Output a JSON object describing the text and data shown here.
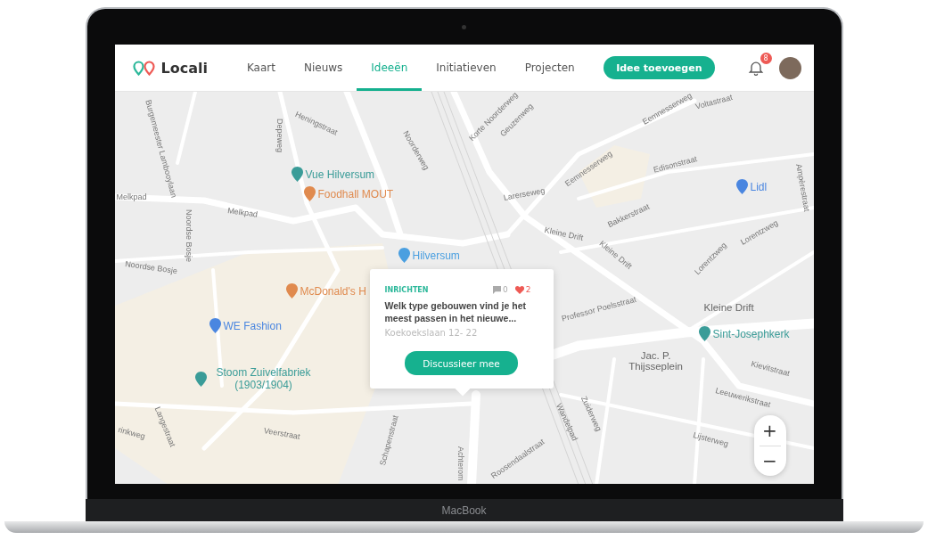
{
  "app": {
    "logo": "Locali"
  },
  "nav": [
    {
      "label": "Kaart",
      "selected": false
    },
    {
      "label": "Nieuws",
      "selected": false
    },
    {
      "label": "Ideeën",
      "selected": true
    },
    {
      "label": "Initiatieven",
      "selected": false
    },
    {
      "label": "Projecten",
      "selected": false
    }
  ],
  "add_button": "Idee toevoegen",
  "notifications": {
    "count": "8"
  },
  "map": {
    "labels": [
      {
        "kind": "poi",
        "text": "Vue Hilversum",
        "color": "#3a9c98"
      },
      {
        "kind": "poi",
        "text": "Foodhall MOUT",
        "color": "#e08a4e"
      },
      {
        "kind": "poi",
        "text": "McDonald's H",
        "color": "#e08a4e"
      },
      {
        "kind": "poi",
        "text": "WE Fashion",
        "color": "#4a86e0"
      },
      {
        "kind": "poi",
        "text": "Hilversum",
        "color": "#4a9fe0"
      },
      {
        "kind": "poi",
        "text": "Lidl",
        "color": "#4a86e0"
      },
      {
        "kind": "poi",
        "text": "Sint-Josephkerk",
        "color": "#3a9c98"
      },
      {
        "kind": "poi",
        "text": "Stoom Zuivelfabriek (1903/1904)",
        "color": "#3a9c98"
      },
      {
        "kind": "place",
        "text": "Kleine Drift"
      },
      {
        "kind": "place",
        "text": "Jac. P. Thijsseplein"
      },
      {
        "kind": "street",
        "text": "Melkpad"
      },
      {
        "kind": "street",
        "text": "Melkpad"
      },
      {
        "kind": "street",
        "text": "Heningstraat"
      },
      {
        "kind": "street",
        "text": "Depeweg"
      },
      {
        "kind": "street",
        "text": "Burgemeester Lambooylaan"
      },
      {
        "kind": "street",
        "text": "Noordse Bosje"
      },
      {
        "kind": "street",
        "text": "Noordse Bosje"
      },
      {
        "kind": "street",
        "text": "Noorderweg"
      },
      {
        "kind": "street",
        "text": "Korte Noorderweg"
      },
      {
        "kind": "street",
        "text": "Geuzenweg"
      },
      {
        "kind": "street",
        "text": "Larerseweg"
      },
      {
        "kind": "street",
        "text": "Eemnesserweg"
      },
      {
        "kind": "street",
        "text": "Eemnesserweg"
      },
      {
        "kind": "street",
        "text": "Edisonstraat"
      },
      {
        "kind": "street",
        "text": "Voltastraat"
      },
      {
        "kind": "street",
        "text": "Bakkerstraat"
      },
      {
        "kind": "street",
        "text": "Kleine Drift"
      },
      {
        "kind": "street",
        "text": "Kleine Drift"
      },
      {
        "kind": "street",
        "text": "Lorentzweg"
      },
      {
        "kind": "street",
        "text": "Lorentzweg"
      },
      {
        "kind": "street",
        "text": "Ampèrestraat"
      },
      {
        "kind": "street",
        "text": "Professor Poelsstraat"
      },
      {
        "kind": "street",
        "text": "Kievitstraat"
      },
      {
        "kind": "street",
        "text": "Leeuwerikstraat"
      },
      {
        "kind": "street",
        "text": "Lijsterweg"
      },
      {
        "kind": "street",
        "text": "Zuiderweg"
      },
      {
        "kind": "street",
        "text": "Wandelpad"
      },
      {
        "kind": "street",
        "text": "Roosendaalstraat"
      },
      {
        "kind": "street",
        "text": "Achterom"
      },
      {
        "kind": "street",
        "text": "Schapenstraat"
      },
      {
        "kind": "street",
        "text": "Veerstraat"
      },
      {
        "kind": "street",
        "text": "Langestraat"
      },
      {
        "kind": "street",
        "text": "rinkweg"
      }
    ]
  },
  "popup": {
    "category": "INRICHTEN",
    "comments": "0",
    "likes": "2",
    "title": "Welk type gebouwen vind je het meest passen in het nieuwe...",
    "address": "Koekoekslaan 12- 22",
    "button": "Discussieer mee"
  },
  "zoom": {
    "in": "+",
    "out": "−"
  },
  "device": {
    "brand": "MacBook"
  }
}
